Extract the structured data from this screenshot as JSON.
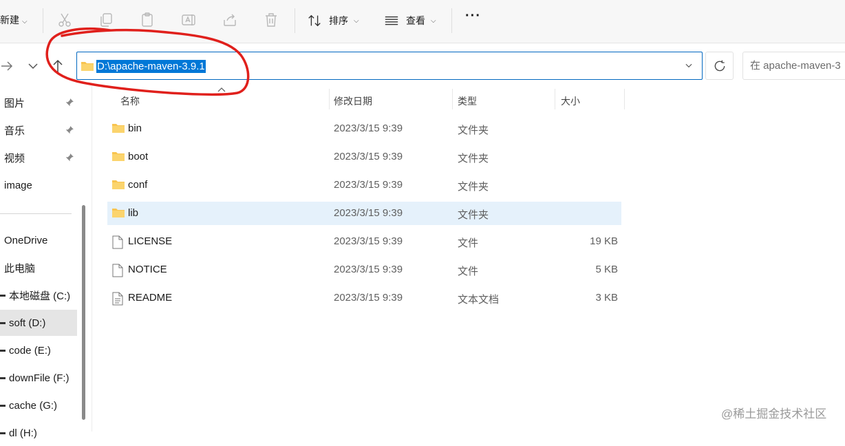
{
  "toolbar": {
    "new_label": "新建",
    "icons": [
      "cut-icon",
      "copy-icon",
      "paste-icon",
      "rename-icon",
      "share-icon",
      "delete-icon"
    ],
    "sort_label": "排序",
    "view_label": "查看",
    "more_label": "···"
  },
  "address": {
    "path": "D:\\apache-maven-3.9.1",
    "search_placeholder": "在 apache-maven-3"
  },
  "sidebar": {
    "items": [
      {
        "label": "图片",
        "pinned": true
      },
      {
        "label": "音乐",
        "pinned": true
      },
      {
        "label": "视频",
        "pinned": true
      },
      {
        "label": "image",
        "pinned": false
      },
      {
        "label": "OneDrive"
      },
      {
        "label": "此电脑"
      },
      {
        "label": "本地磁盘 (C:)"
      },
      {
        "label": "soft (D:)",
        "selected": true
      },
      {
        "label": "code (E:)"
      },
      {
        "label": "downFile (F:)"
      },
      {
        "label": "cache (G:)"
      },
      {
        "label": "dl (H:)"
      }
    ]
  },
  "columns": {
    "name": "名称",
    "modified": "修改日期",
    "type": "类型",
    "size": "大小"
  },
  "files": [
    {
      "name": "bin",
      "modified": "2023/3/15 9:39",
      "type": "文件夹",
      "size": "",
      "kind": "folder"
    },
    {
      "name": "boot",
      "modified": "2023/3/15 9:39",
      "type": "文件夹",
      "size": "",
      "kind": "folder"
    },
    {
      "name": "conf",
      "modified": "2023/3/15 9:39",
      "type": "文件夹",
      "size": "",
      "kind": "folder"
    },
    {
      "name": "lib",
      "modified": "2023/3/15 9:39",
      "type": "文件夹",
      "size": "",
      "kind": "folder",
      "selected": true
    },
    {
      "name": "LICENSE",
      "modified": "2023/3/15 9:39",
      "type": "文件",
      "size": "19 KB",
      "kind": "file"
    },
    {
      "name": "NOTICE",
      "modified": "2023/3/15 9:39",
      "type": "文件",
      "size": "5 KB",
      "kind": "file"
    },
    {
      "name": "README",
      "modified": "2023/3/15 9:39",
      "type": "文本文档",
      "size": "3 KB",
      "kind": "text"
    }
  ],
  "watermark": "@稀土掘金技术社区",
  "colors": {
    "accent": "#0078d7",
    "selection": "#e5f1fb",
    "folder": "#f8c44f",
    "annotation": "#e0201c"
  }
}
